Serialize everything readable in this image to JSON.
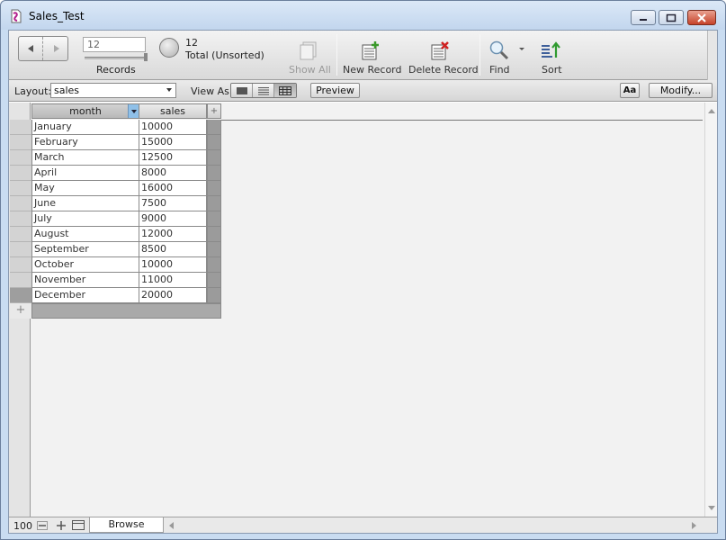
{
  "window": {
    "title": "Sales_Test"
  },
  "toolbar": {
    "record_number": "12",
    "records_label": "Records",
    "found_count": "12",
    "found_status": "Total (Unsorted)",
    "show_all_label": "Show All",
    "new_record_label": "New Record",
    "delete_record_label": "Delete Record",
    "find_label": "Find",
    "sort_label": "Sort"
  },
  "layoutbar": {
    "layout_label": "Layout:",
    "layout_value": "sales",
    "view_as_label": "View As:",
    "preview_label": "Preview",
    "aa_label": "Aa",
    "modify_label": "Modify..."
  },
  "table": {
    "columns": [
      "month",
      "sales"
    ],
    "add_field_label": "+",
    "rows": [
      {
        "month": "January",
        "sales": "10000"
      },
      {
        "month": "February",
        "sales": "15000"
      },
      {
        "month": "March",
        "sales": "12500"
      },
      {
        "month": "April",
        "sales": "8000"
      },
      {
        "month": "May",
        "sales": "16000"
      },
      {
        "month": "June",
        "sales": "7500"
      },
      {
        "month": "July",
        "sales": "9000"
      },
      {
        "month": "August",
        "sales": "12000"
      },
      {
        "month": "September",
        "sales": "8500"
      },
      {
        "month": "October",
        "sales": "10000"
      },
      {
        "month": "November",
        "sales": "11000"
      },
      {
        "month": "December",
        "sales": "20000"
      }
    ],
    "new_record_symbol": "+"
  },
  "statusbar": {
    "zoom": "100",
    "mode": "Browse"
  },
  "colors": {
    "title_bar": "#c9dcf1",
    "close_button": "#c6432a",
    "sort_indicator": "#8fc0e8"
  },
  "icons": {
    "app": "document-icon",
    "find": "magnifier-icon",
    "sort": "sort-icon",
    "new_record": "new-record-icon",
    "delete_record": "delete-record-icon"
  }
}
